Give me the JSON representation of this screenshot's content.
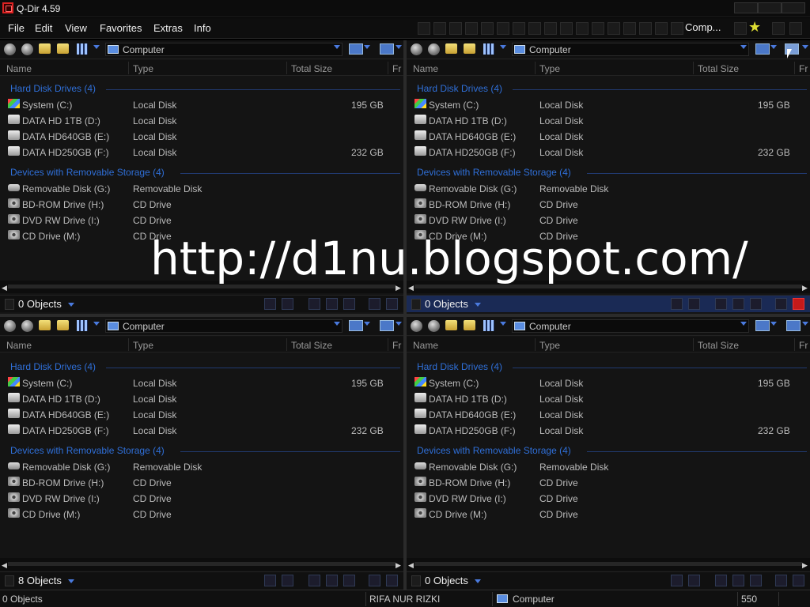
{
  "app": {
    "title": "Q-Dir 4.59"
  },
  "menu": {
    "file": "File",
    "edit": "Edit",
    "view": "View",
    "favorites": "Favorites",
    "extras": "Extras",
    "info": "Info"
  },
  "toolbar": {
    "comp_label": "Comp..."
  },
  "columns": {
    "name": "Name",
    "type": "Type",
    "total_size": "Total Size",
    "free": "Fr"
  },
  "groups": {
    "hard_disks": "Hard Disk Drives (4)",
    "removable": "Devices with Removable Storage (4)"
  },
  "drives": [
    {
      "name": "System (C:)",
      "type": "Local Disk",
      "size": "195 GB",
      "icon": "system-drive-icon"
    },
    {
      "name": "DATA HD 1TB (D:)",
      "type": "Local Disk",
      "size": "",
      "icon": "hard-disk-icon"
    },
    {
      "name": "DATA HD640GB (E:)",
      "type": "Local Disk",
      "size": "",
      "icon": "hard-disk-icon"
    },
    {
      "name": "DATA HD250GB (F:)",
      "type": "Local Disk",
      "size": "232 GB",
      "icon": "hard-disk-icon"
    }
  ],
  "removables": [
    {
      "name": "Removable Disk (G:)",
      "type": "Removable Disk",
      "icon": "removable-disk-icon"
    },
    {
      "name": "BD-ROM Drive (H:)",
      "type": "CD Drive",
      "icon": "cd-drive-icon"
    },
    {
      "name": "DVD RW Drive (I:)",
      "type": "CD Drive",
      "icon": "cd-drive-icon"
    },
    {
      "name": "CD Drive (M:)",
      "type": "CD Drive",
      "icon": "cd-drive-icon"
    }
  ],
  "panes": [
    {
      "address": "Computer",
      "objects": "0 Objects"
    },
    {
      "address": "Computer",
      "objects": "0 Objects"
    },
    {
      "address": "Computer",
      "objects": "8 Objects"
    },
    {
      "address": "Computer",
      "objects": "0 Objects"
    }
  ],
  "statusbar": {
    "objects": "0 Objects",
    "user": "RIFA NUR RIZKI",
    "location": "Computer",
    "number": "550"
  },
  "watermark": "http://d1nu.blogspot.com/",
  "colors": {
    "accent": "#2f6fd8",
    "active_status": "#1a2a55",
    "background": "#141414"
  }
}
